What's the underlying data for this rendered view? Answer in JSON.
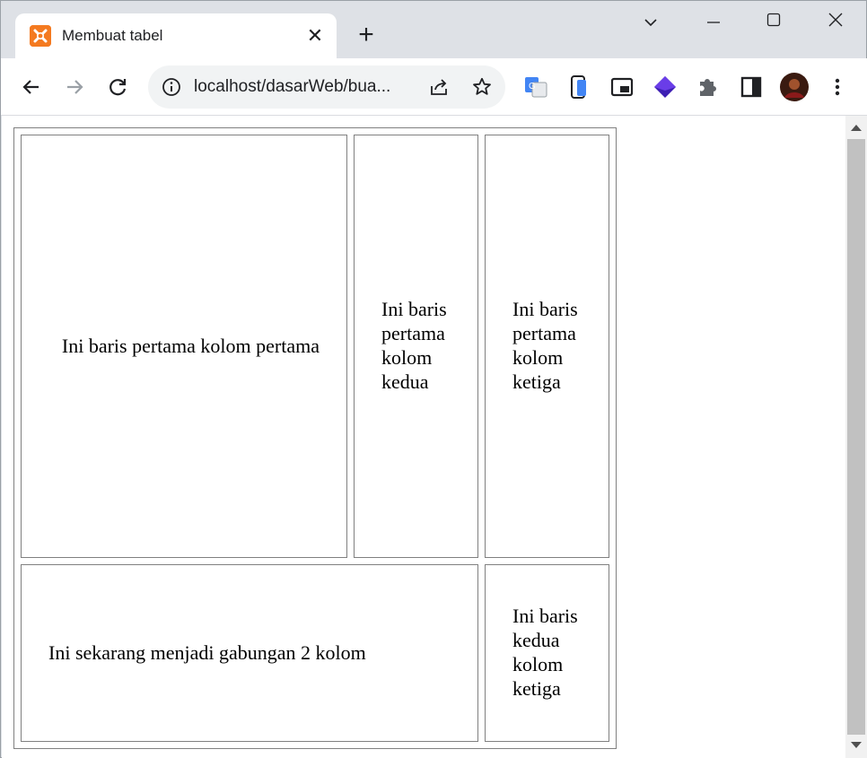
{
  "browser": {
    "tab_title": "Membuat tabel",
    "close_glyph": "✕",
    "new_tab_glyph": "+",
    "url": "localhost/dasarWeb/bua...",
    "icons": [
      "tab-search-icon",
      "minimize-icon",
      "maximize-icon",
      "close-window-icon",
      "back-icon",
      "forward-icon",
      "reload-icon",
      "site-info-icon",
      "share-icon",
      "bookmark-star-icon",
      "translate-icon",
      "phone-icon",
      "picture-in-picture-icon",
      "extension-diamond-icon",
      "extensions-puzzle-icon",
      "side-panel-icon",
      "profile-avatar",
      "menu-icon"
    ]
  },
  "table": {
    "row1": {
      "col1": "Ini baris pertama kolom pertama",
      "col2": "Ini baris pertama kolom kedua",
      "col3": "Ini baris pertama kolom ketiga"
    },
    "row2": {
      "merged": "Ini sekarang menjadi gabungan 2 kolom",
      "col3": "Ini baris kedua kolom ketiga"
    }
  },
  "colors": {
    "highlight_text": "#ff0000",
    "xampp_orange": "#f47a20"
  }
}
